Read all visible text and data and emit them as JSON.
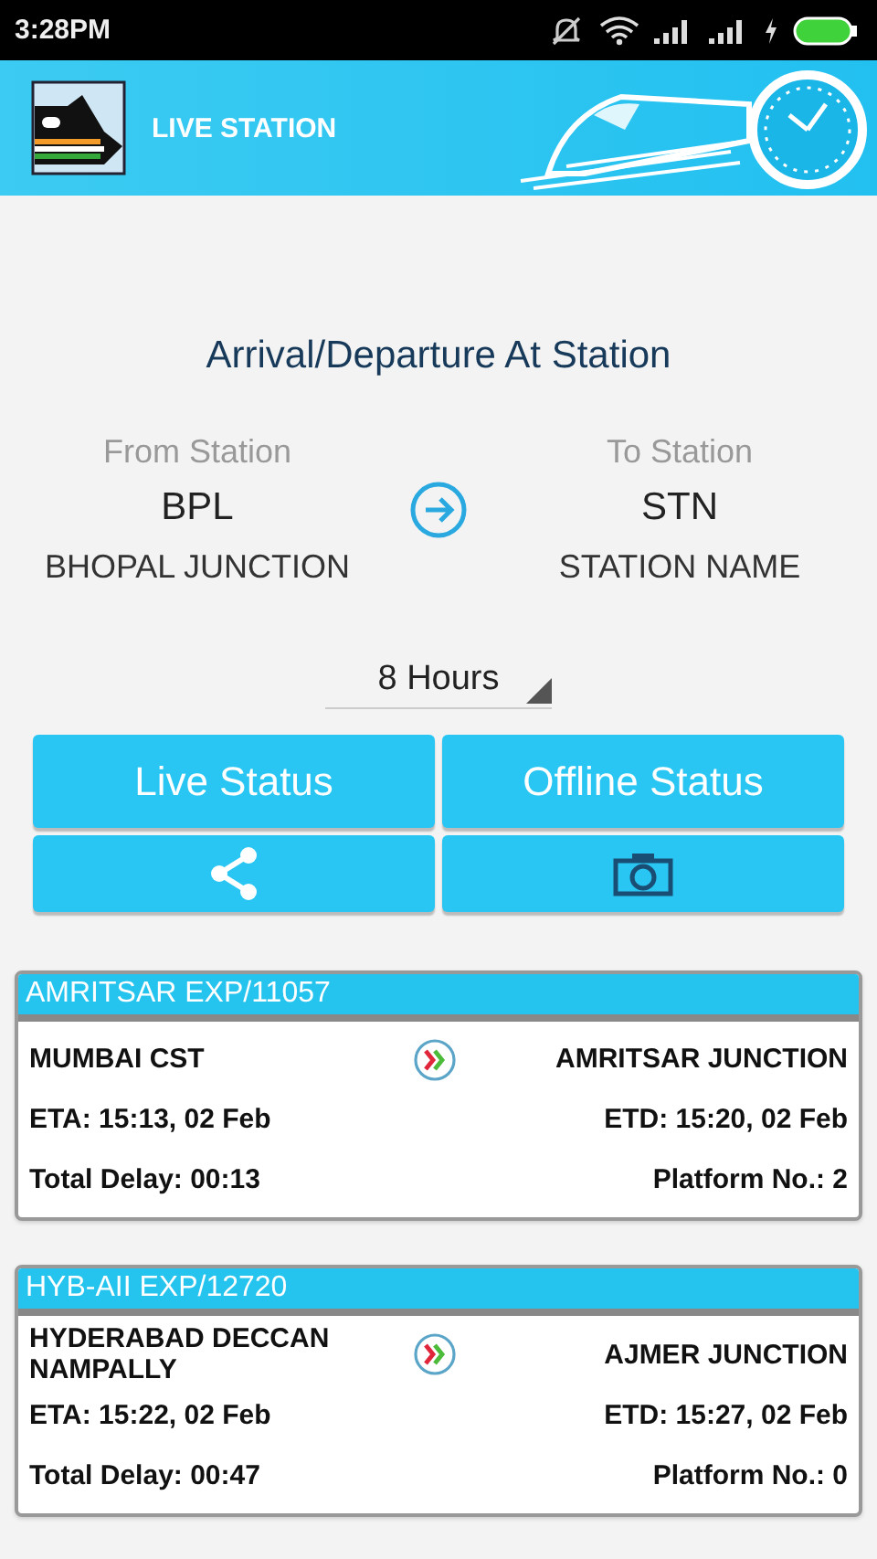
{
  "status_bar": {
    "time": "3:28PM"
  },
  "header": {
    "title": "LIVE STATION"
  },
  "page_title": "Arrival/Departure At Station",
  "from": {
    "label": "From Station",
    "code": "BPL",
    "name": "BHOPAL JUNCTION"
  },
  "to": {
    "label": "To Station",
    "code": "STN",
    "name": "STATION NAME"
  },
  "duration": {
    "value": "8 Hours"
  },
  "actions": [
    {
      "kind": "text",
      "label": "Live Status"
    },
    {
      "kind": "text",
      "label": "Offline Status"
    },
    {
      "kind": "share"
    },
    {
      "kind": "camera"
    }
  ],
  "trains": [
    {
      "title": "AMRITSAR EXP/11057",
      "from": "MUMBAI CST",
      "to": "AMRITSAR JUNCTION",
      "eta": "ETA: 15:13, 02 Feb",
      "etd": "ETD: 15:20, 02 Feb",
      "delay": "Total Delay: 00:13",
      "platform": "Platform No.: 2"
    },
    {
      "title": "HYB-AII EXP/12720",
      "from": "HYDERABAD DECCAN NAMPALLY",
      "to": "AJMER JUNCTION",
      "eta": "ETA: 15:22, 02 Feb",
      "etd": "ETD: 15:27, 02 Feb",
      "delay": "Total Delay: 00:47",
      "platform": "Platform No.: 0"
    }
  ]
}
